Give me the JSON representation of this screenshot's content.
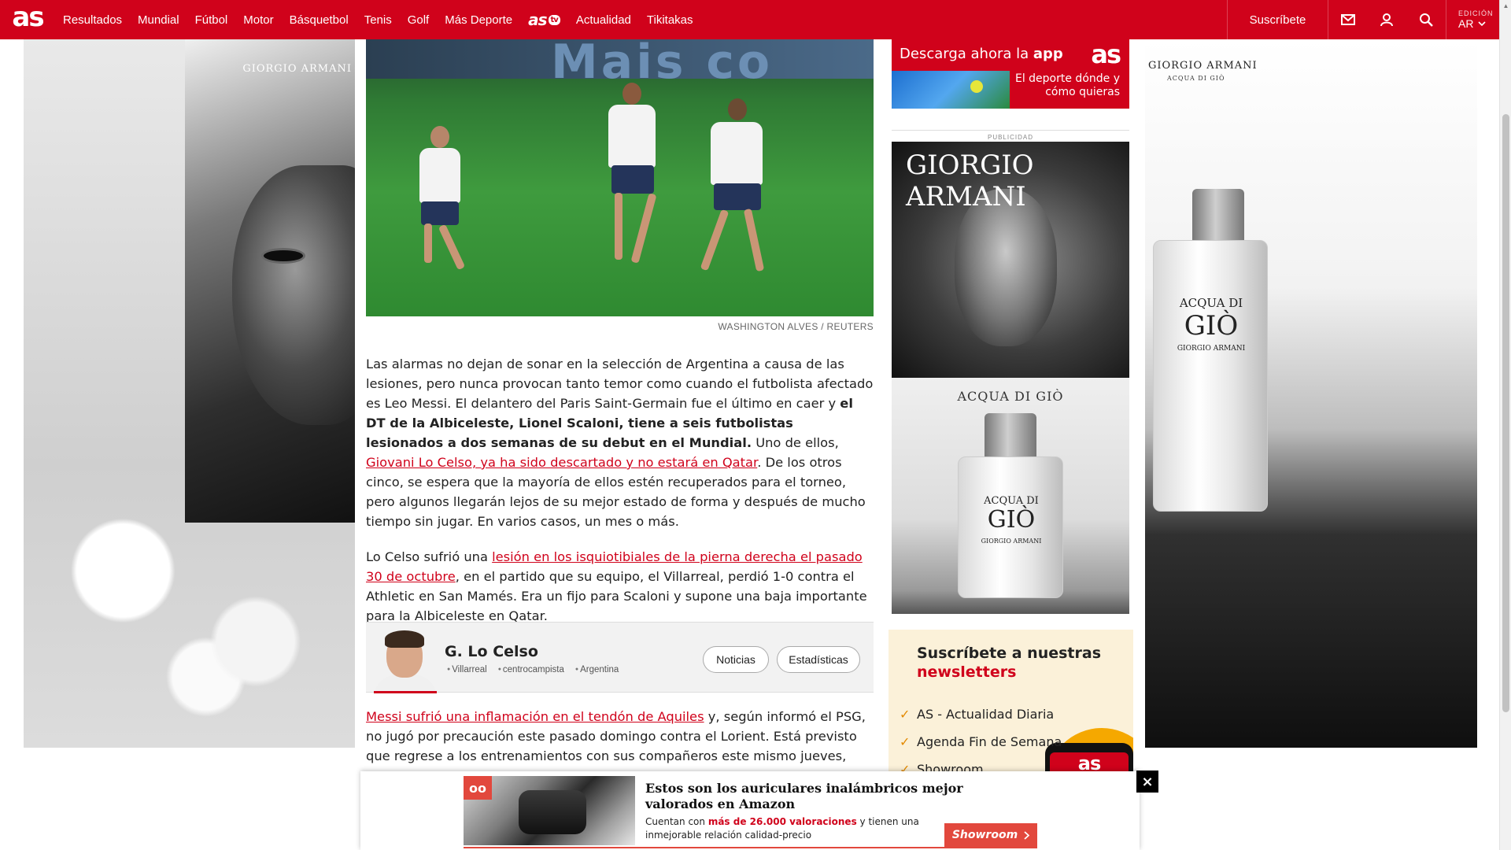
{
  "header": {
    "logo": "as",
    "nav": [
      "Resultados",
      "Mundial",
      "Fútbol",
      "Motor",
      "Básquetbol",
      "Tenis",
      "Golf",
      "Más Deporte"
    ],
    "brand_item": "as",
    "brand_tv": "tv",
    "nav_after": [
      "Actualidad",
      "Tikitakas"
    ],
    "subscribe": "Suscríbete",
    "edition_label": "EDICIÓN",
    "edition_value": "AR",
    "icons": [
      "mail-icon",
      "user-icon",
      "search-icon",
      "chevron-down-icon"
    ],
    "brand_color": "#d0021b"
  },
  "ads": {
    "left_brand": "GIORGIO ARMANI",
    "right_brand": "GIORGIO ARMANI",
    "right_sub": "ACQUA DI GIÒ",
    "bottle_label_1": "ACQUA DI",
    "bottle_label_2": "GIÒ",
    "bottle_label_3": "GIORGIO ARMANI"
  },
  "article": {
    "photo_banner_text": "Mais co",
    "photo_credit": "WASHINGTON ALVES / REUTERS",
    "p1_a": "Las alarmas no dejan de sonar en la selección de Argentina a causa de las lesiones, pero nunca provocan tanto temor como cuando el futbolista afectado es Leo Messi. El delantero del Paris Saint-Germain fue el último en caer y ",
    "p1_bold": "el DT de la Albiceleste, Lionel Scaloni, tiene a seis futbolistas lesionados a dos semanas de su debut en el Mundial.",
    "p1_b": " Uno de ellos, ",
    "p1_link": "Giovani Lo Celso, ya ha sido descartado y no estará en Qatar",
    "p1_c": ". De los otros cinco, se espera que la mayoría de ellos estén recuperados para el torneo, pero algunos llegarán lejos de su mejor estado de forma y después de mucho tiempo sin jugar. En varios casos, un mes o más.",
    "p2_a": "Lo Celso sufrió una ",
    "p2_link": "lesión en los isquiotibiales de la pierna derecha el pasado 30 de octubre",
    "p2_b": ", en el partido que su equipo, el Villarreal, perdió 1-0 contra el Athletic en San Mamés. Era un fijo para Scaloni y supone una baja importante para la Albiceleste en Qatar.",
    "p3_link": "Messi sufrió una inflamación en el tendón de Aquiles",
    "p3_a": " y, según informó el PSG, no jugó por precaución este pasado domingo contra el Lorient. Está previsto que regrese a los entrenamientos con sus compañeros este mismo jueves, pero se"
  },
  "player_card": {
    "name": "G. Lo Celso",
    "tags": [
      "Villarreal",
      "centrocampista",
      "Argentina"
    ],
    "news_button": "Noticias",
    "stats_button": "Estadísticas"
  },
  "rail": {
    "app_ad_prefix": "Descarga ahora la ",
    "app_ad_bold": "app",
    "app_ad_logo": "as",
    "app_ad_tagline": "El deporte dónde y cómo quieras",
    "pub_label": "PUBLICIDAD",
    "armani_title": "GIORGIO ARMANI",
    "aqua_title": "ACQUA DI GIÒ"
  },
  "newsletter": {
    "title_1": "Suscríbete a nuestras",
    "title_2": "newsletters",
    "items": [
      "AS - Actualidad Diaria",
      "Agenda Fin de Semana",
      "Showroom"
    ],
    "phone_logo": "as"
  },
  "sticky_ad": {
    "badge": "oo",
    "headline": "Estos son los auriculares inalámbricos mejor valorados en Amazon",
    "sub_a": "Cuentan con ",
    "sub_highlight": "más de 26.000 valoraciones",
    "sub_b": " y tienen una inmejorable relación calidad-precio",
    "cta": "Showroom",
    "close": "×"
  }
}
